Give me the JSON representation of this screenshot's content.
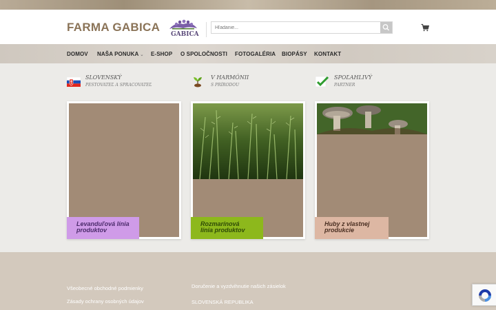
{
  "header": {
    "brand": "FARMA GABICA",
    "logo_text": "GABICA",
    "search_placeholder": "Hľadanie..."
  },
  "nav": {
    "items": [
      {
        "label": "DOMOV"
      },
      {
        "label": "NAŠA PONUKA"
      },
      {
        "label": "E-SHOP"
      },
      {
        "label": "O SPOLOČNOSTI"
      },
      {
        "label": "FOTOGALÉRIA"
      },
      {
        "label": "BIOPÁSY"
      },
      {
        "label": "KONTAKT"
      }
    ]
  },
  "features": [
    {
      "title": "SLOVENSKÝ",
      "subtitle": "PESTOVATEĽ A SPRACOVATEĽ",
      "icon": "slovak-flag-icon"
    },
    {
      "title": "V HARMÓNII",
      "subtitle": "S PRÍRODOU",
      "icon": "sprout-icon"
    },
    {
      "title": "SPOĽAHLIVÝ",
      "subtitle": "PARTNER",
      "icon": "checkmark-icon"
    }
  ],
  "cards": [
    {
      "label": "Levanduľová línia produktov",
      "label_color": "#cf9be8",
      "text_color": "#4a2a6a"
    },
    {
      "label": "Rozmarínová línia produktov",
      "label_color": "#8db81c",
      "text_color": "#2e4a06"
    },
    {
      "label": "Huby z vlastnej produkcie",
      "label_color": "#ddb7a3",
      "text_color": "#4a2f22"
    }
  ],
  "footer": {
    "links_left": [
      "Všeobecné obchodné podmienky",
      "Zásady ochrany osobných údajov"
    ],
    "links_right": [
      "Doručenie a vyzdvihnutie našich zásielok",
      "SLOVENSKÁ REPUBLIKA"
    ]
  },
  "colors": {
    "brand": "#8a7357",
    "card_fill": "#a28b76",
    "footer": "#d3c9bd"
  }
}
